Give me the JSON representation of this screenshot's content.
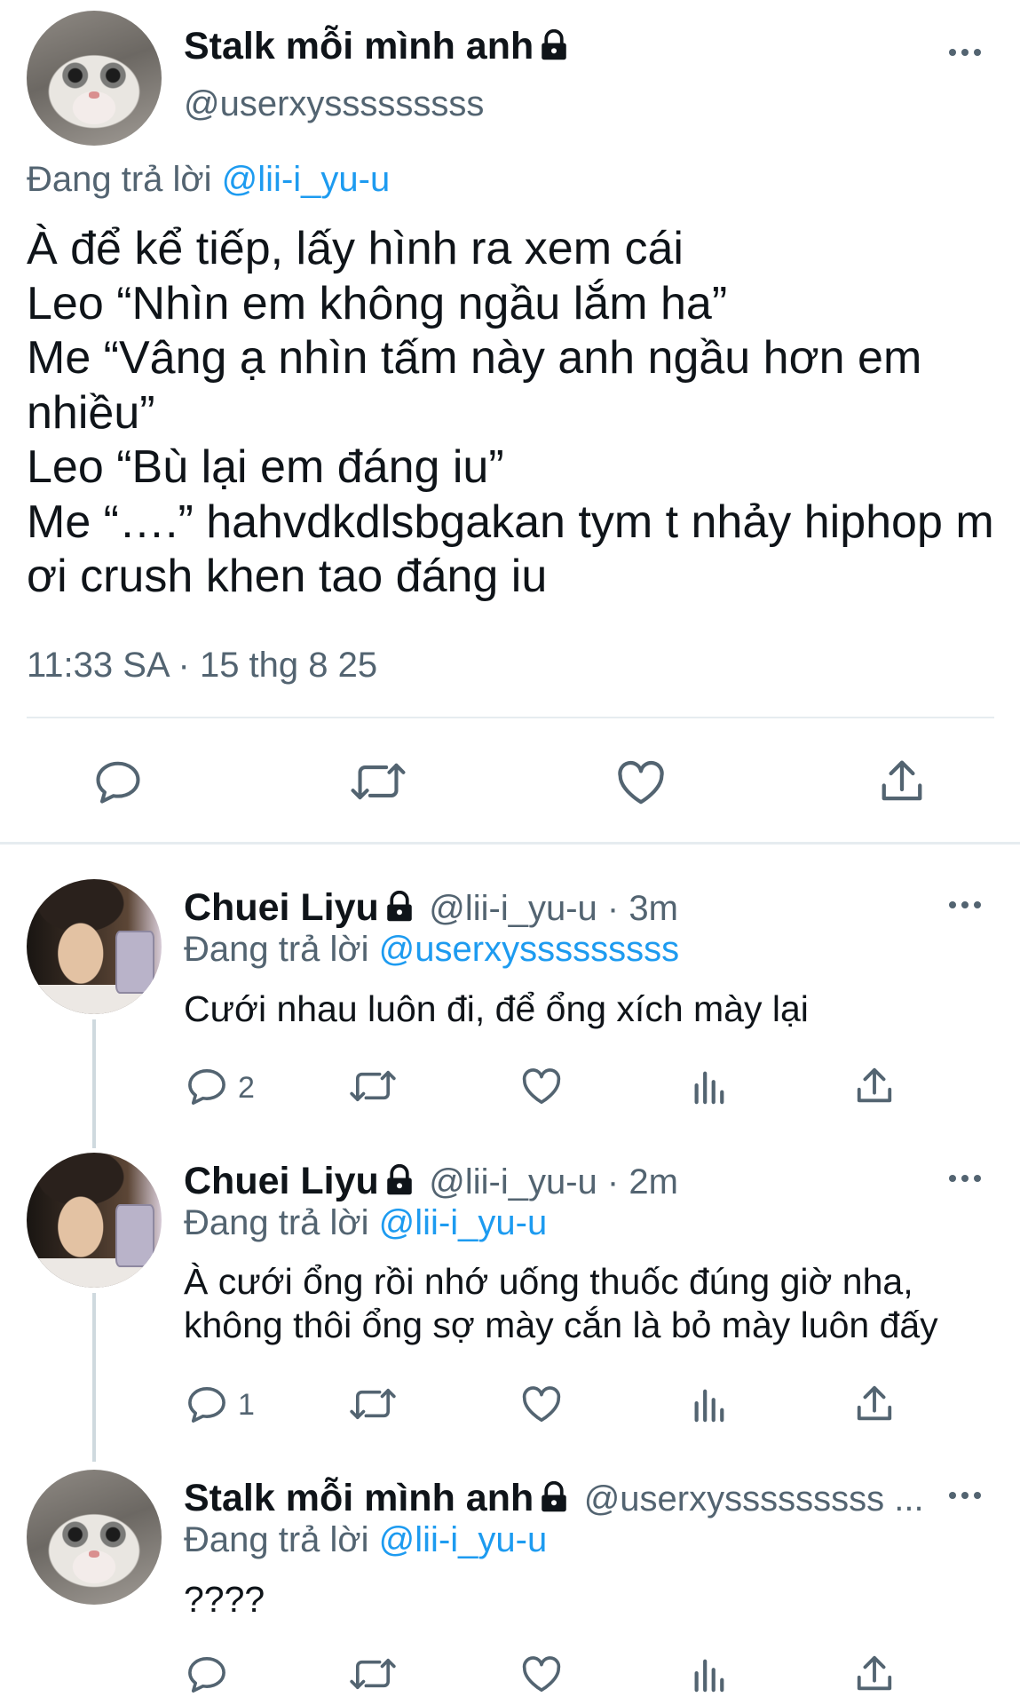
{
  "main_tweet": {
    "author_name": "Stalk mỗi mình anh",
    "author_handle": "@userxysssssssss",
    "replying_prefix": "Đang trả lời",
    "replying_to": "@lii-i_yu-u",
    "text": "À để kể tiếp, lấy hình ra xem cái\nLeo “Nhìn em không ngầu lắm ha”\nMe “Vâng ạ nhìn tấm này anh ngầu hơn em nhiều”\nLeo “Bù lại em đáng iu”\nMe “….” hahvdkdlsbgakan tym t nhảy hiphop m ơi crush khen tao đáng iu",
    "timestamp": "11:33 SA · 15 thg 8 25"
  },
  "replies": [
    {
      "author_name": "Chuei Liyu",
      "handle_time": "@lii-i_yu-u · 3m",
      "replying_prefix": "Đang trả lời",
      "replying_to": "@userxysssssssss",
      "text": "Cưới nhau luôn đi, để ổng xích mày lại",
      "reply_count": "2"
    },
    {
      "author_name": "Chuei Liyu",
      "handle_time": "@lii-i_yu-u · 2m",
      "replying_prefix": "Đang trả lời",
      "replying_to": "@lii-i_yu-u",
      "text": "À cưới ổng rồi nhớ uống thuốc đúng giờ nha,\nkhông thôi ổng sợ mày cắn là bỏ mày luôn đấy",
      "reply_count": "1"
    },
    {
      "author_name": "Stalk mỗi mình anh",
      "handle_time": "@userxysssssssss ...",
      "replying_prefix": "Đang trả lời",
      "replying_to": "@lii-i_yu-u",
      "text": "????",
      "reply_count": ""
    }
  ],
  "icons": {
    "reply": "reply-icon",
    "retweet": "retweet-icon",
    "like": "like-icon",
    "views": "views-icon",
    "share": "share-icon",
    "lock": "lock-icon",
    "more": "more-icon"
  },
  "colors": {
    "link": "#1d9bf0",
    "secondary": "#536471",
    "text": "#0f1419",
    "divider": "#e6ecf0"
  }
}
